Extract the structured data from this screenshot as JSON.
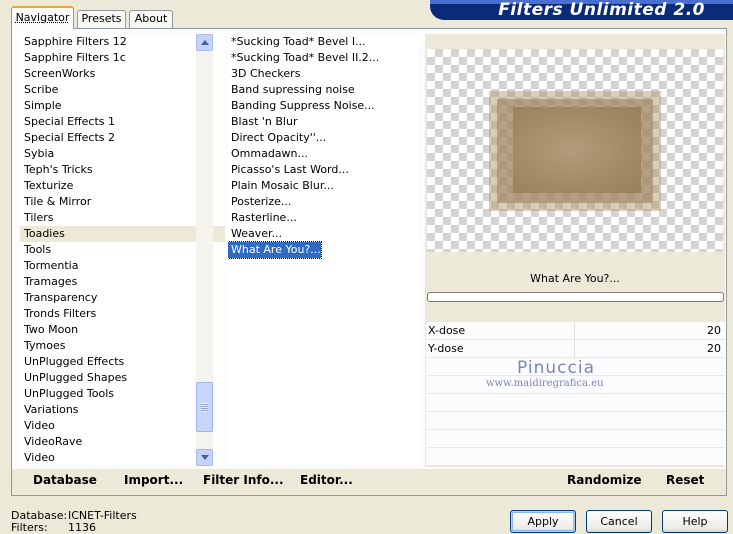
{
  "header": {
    "title": "Filters Unlimited 2.0"
  },
  "tabs": [
    {
      "label": "Navigator"
    },
    {
      "label": "Presets"
    },
    {
      "label": "About"
    }
  ],
  "categories": [
    "Sapphire Filters 12",
    "Sapphire Filters 1c",
    "ScreenWorks",
    "Scribe",
    "Simple",
    "Special Effects 1",
    "Special Effects 2",
    "Sybia",
    "Teph's Tricks",
    "Texturize",
    "Tile & Mirror",
    "Tilers",
    "Toadies",
    "Tools",
    "Tormentia",
    "Tramages",
    "Transparency",
    "Tronds Filters",
    "Two Moon",
    "Tymoes",
    "UnPlugged Effects",
    "UnPlugged Shapes",
    "UnPlugged Tools",
    "Variations",
    "Video",
    "VideoRave",
    "Video"
  ],
  "selected_category": "Toadies",
  "filters": [
    "*Sucking Toad*  Bevel I...",
    "*Sucking Toad*  Bevel II.2...",
    "3D Checkers",
    "Band supressing noise",
    "Banding Suppress Noise...",
    "Blast 'n Blur",
    "Direct Opacity''...",
    "Ommadawn...",
    "Picasso's Last Word...",
    "Plain Mosaic Blur...",
    "Posterize...",
    "Rasterline...",
    "Weaver...",
    "What Are You?..."
  ],
  "selected_filter": "What Are You?...",
  "preview": {
    "filter_name": "What Are You?..."
  },
  "params": [
    {
      "label": "X-dose",
      "value": "20"
    },
    {
      "label": "Y-dose",
      "value": "20"
    }
  ],
  "watermark": {
    "name": "Pinuccia",
    "url": "www.maidiregrafica.eu"
  },
  "toolbar": {
    "database": "Database",
    "import": "Import...",
    "filter_info": "Filter Info...",
    "editor": "Editor...",
    "randomize": "Randomize",
    "reset": "Reset"
  },
  "status": {
    "database_label": "Database:",
    "database_value": "ICNET-Filters",
    "filters_label": "Filters:",
    "filters_value": "1136"
  },
  "dialog": {
    "apply": "Apply",
    "cancel": "Cancel",
    "help": "Help"
  },
  "colors": {
    "selection": "#316ac5",
    "banner": "#0a2a7a",
    "tab_accent": "#f0a531"
  }
}
